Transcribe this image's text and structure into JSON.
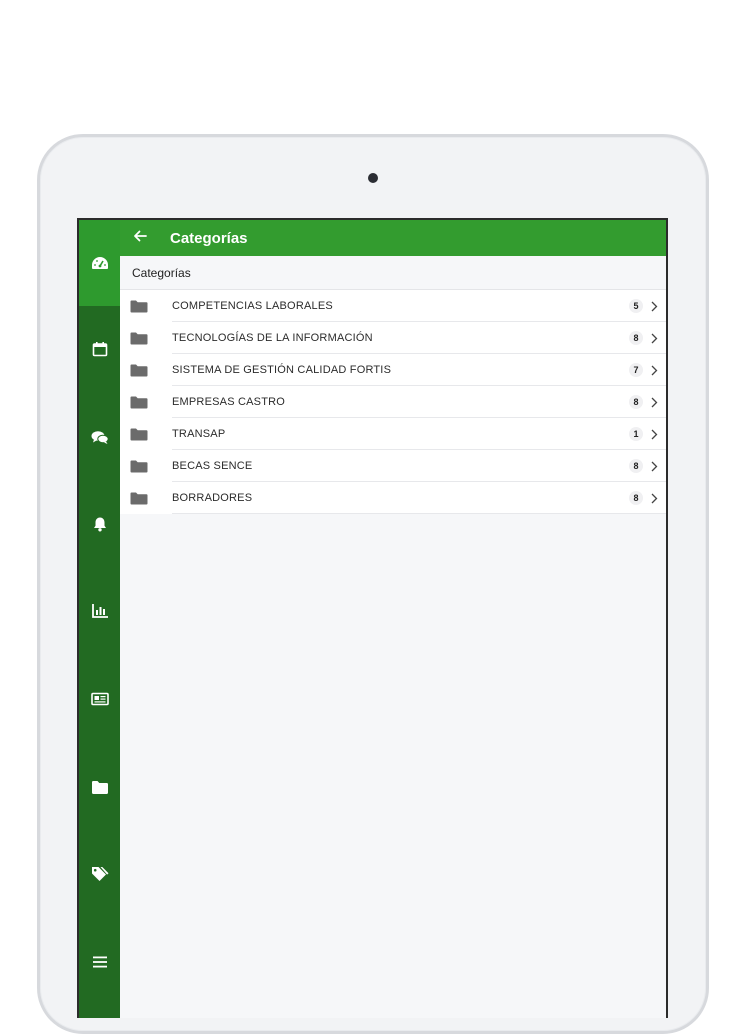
{
  "appbar": {
    "title": "Categorías"
  },
  "section": {
    "label": "Categorías"
  },
  "categories": [
    {
      "name": "COMPETENCIAS LABORALES",
      "count": "5"
    },
    {
      "name": "TECNOLOGÍAS DE LA INFORMACIÓN",
      "count": "8"
    },
    {
      "name": "SISTEMA DE GESTIÓN CALIDAD FORTIS",
      "count": "7"
    },
    {
      "name": "EMPRESAS CASTRO",
      "count": "8"
    },
    {
      "name": "TRANSAP",
      "count": "1"
    },
    {
      "name": "BECAS SENCE",
      "count": "8"
    },
    {
      "name": "BORRADORES",
      "count": "8"
    }
  ],
  "sidebar": {
    "icons": [
      "dashboard-icon",
      "calendar-icon",
      "chat-icon",
      "bell-icon",
      "chart-icon",
      "news-icon",
      "folder-icon",
      "tags-icon",
      "menu-icon"
    ]
  },
  "colors": {
    "sidebar": "#226a22",
    "sidebar_active": "#2e9a2e",
    "appbar": "#339c2f"
  }
}
